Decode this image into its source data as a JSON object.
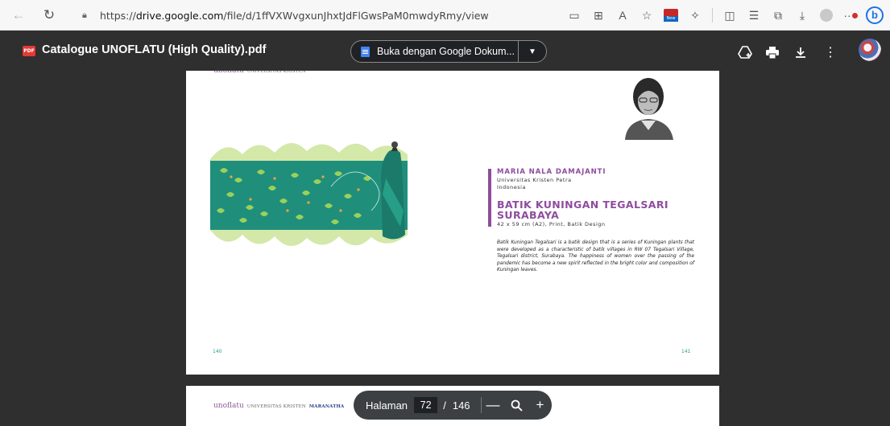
{
  "browser": {
    "url_prefix": "https://",
    "url_host": "drive.google.com",
    "url_path": "/file/d/1ffVXWvgxunJhxtJdFlGwsPaM0mwdyRmy/view",
    "new_badge": "New"
  },
  "header": {
    "pdf_badge": "PDF",
    "file_title": "Catalogue UNOFLATU (High Quality).pdf",
    "open_with_label": "Buka dengan Google Dokum..."
  },
  "page": {
    "logo_main": "unoflatu",
    "logo_uni": "UNIVERSITAS KRISTEN",
    "logo_mar": "MARANATHA",
    "artist": "MARIA NALA DAMAJANTI",
    "university": "Universitas Kristen Petra",
    "country": "Indonesia",
    "work_title": "BATIK KUNINGAN TEGALSARI SURABAYA",
    "details": "42 x 59 cm (A2), Print, Batik Design",
    "description": "Batik Kuningan Tegalsari is a batik design that is a series of Kuningan plants that were developed as a characteristic of batik villages in RW 07 Tegalsari Village, Tegalsari district, Surabaya. The happiness of women over the passing of the pandemic has become a new spirit reflected in the bright color and composition of Kuningan leaves.",
    "page_left": "140",
    "page_right": "141"
  },
  "page_nav": {
    "label": "Halaman",
    "current": "72",
    "separator": "/",
    "total": "146",
    "zoom_out": "—",
    "zoom_in": "+"
  },
  "icons": {
    "back": "arrow-left",
    "refresh": "refresh",
    "lock": "lock",
    "add_to_drive": "add-to-drive",
    "print": "print",
    "download": "download",
    "more": "more-vertical",
    "zoom": "magnifier"
  },
  "colors": {
    "accent_purple": "#8e4c9e",
    "batik_teal": "#1f8f7c",
    "page_number": "#2a9d8f"
  }
}
